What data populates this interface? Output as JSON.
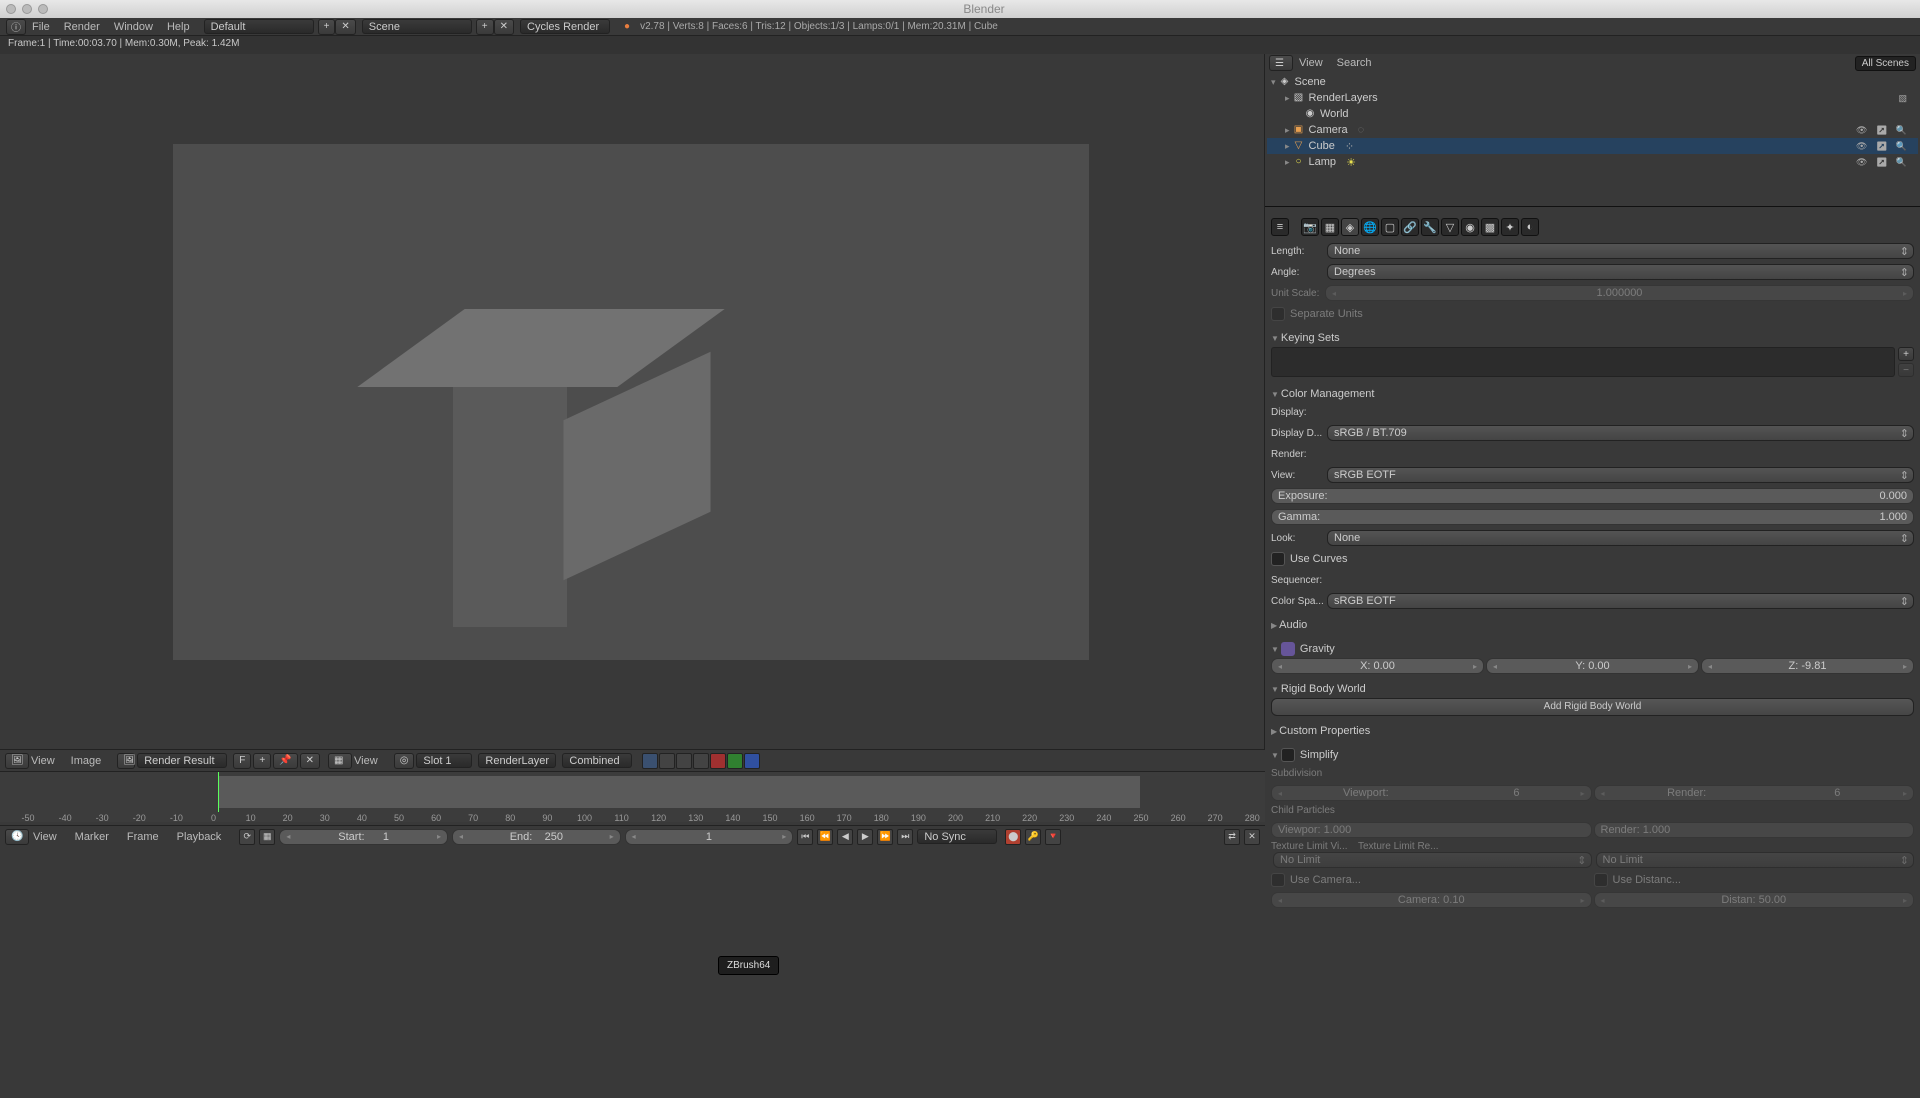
{
  "window": {
    "title": "Blender"
  },
  "header": {
    "menus": [
      "File",
      "Render",
      "Window",
      "Help"
    ],
    "layout": "Default",
    "scene": "Scene",
    "engine": "Cycles Render",
    "stats": "v2.78 | Verts:8 | Faces:6 | Tris:12 | Objects:1/3 | Lamps:0/1 | Mem:20.31M | Cube"
  },
  "renderInfo": "Frame:1 | Time:00:03.70 | Mem:0.30M, Peak: 1.42M",
  "outliner": {
    "head": {
      "view": "View",
      "search": "Search",
      "filter": "All Scenes"
    },
    "scene": "Scene",
    "items": [
      {
        "name": "RenderLayers",
        "icon": "▧",
        "vis": ""
      },
      {
        "name": "World",
        "icon": "◉",
        "vis": ""
      },
      {
        "name": "Camera",
        "icon": "🎥",
        "vis": "👁 ↗ 🔍"
      },
      {
        "name": "Cube",
        "icon": "▽",
        "vis": "👁 ↗ 🔍"
      },
      {
        "name": "Lamp",
        "icon": "○",
        "vis": "👁 ↗ 🔍"
      }
    ]
  },
  "props": {
    "units": {
      "length": "None",
      "angle": "Degrees",
      "scaleLabel": "Unit Scale:",
      "scale": "1.000000",
      "separate": "Separate Units"
    },
    "panels": {
      "keying": "Keying Sets",
      "color": "Color Management",
      "audio": "Audio",
      "gravity": "Gravity",
      "rigid": "Rigid Body World",
      "custom": "Custom Properties",
      "simplify": "Simplify"
    },
    "color": {
      "displayH": "Display:",
      "displayD": "Display D...",
      "displayDV": "sRGB / BT.709",
      "renderH": "Render:",
      "view": "View:",
      "viewV": "sRGB EOTF",
      "exposure": "Exposure:",
      "exposureV": "0.000",
      "gamma": "Gamma:",
      "gammaV": "1.000",
      "look": "Look:",
      "lookV": "None",
      "curves": "Use Curves",
      "seqH": "Sequencer:",
      "colorSp": "Color Spa...",
      "colorSpV": "sRGB EOTF"
    },
    "gravity": {
      "x": "X: 0.00",
      "y": "Y: 0.00",
      "z": "Z: -9.81"
    },
    "rigidBtn": "Add Rigid Body World",
    "simplify": {
      "sub": "Subdivision",
      "viewport": "Viewport:",
      "viewportV": "6",
      "render": "Render:",
      "renderV": "6",
      "child": "Child Particles",
      "vp2": "Viewpor: 1.000",
      "rn2": "Render:   1.000",
      "texV": "Texture Limit Vi...",
      "texR": "Texture Limit Re...",
      "noLimit": "No Limit",
      "useCam": "Use Camera...",
      "useDist": "Use Distanc...",
      "cam": "Camera: 0.10",
      "dist": "Distan: 50.00"
    }
  },
  "imgHeader": {
    "view": "View",
    "image": "Image",
    "result": "Render Result",
    "f": "F",
    "viewBtn": "View",
    "slot": "Slot 1",
    "layer": "RenderLayer",
    "pass": "Combined"
  },
  "timeline": {
    "ticks": [
      -50,
      -40,
      -30,
      -20,
      -10,
      0,
      10,
      20,
      30,
      40,
      50,
      60,
      70,
      80,
      90,
      100,
      110,
      120,
      130,
      140,
      150,
      160,
      170,
      180,
      190,
      200,
      210,
      220,
      230,
      240,
      250,
      260,
      270,
      280
    ],
    "startPx": 28,
    "stepPx": 37.1
  },
  "tlFooter": {
    "view": "View",
    "marker": "Marker",
    "frame": "Frame",
    "playback": "Playback",
    "start": "Start:",
    "startV": "1",
    "end": "End:",
    "endV": "250",
    "cur": "1",
    "sync": "No Sync"
  },
  "tooltip": "ZBrush64",
  "labels": {
    "lengthL": "Length:",
    "angleL": "Angle:"
  }
}
